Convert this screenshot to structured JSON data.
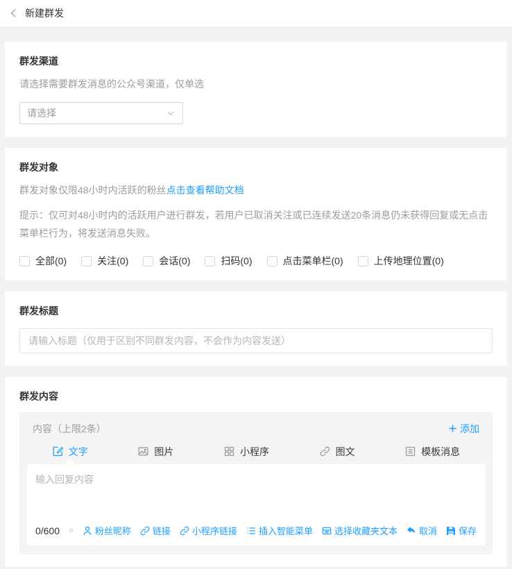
{
  "colors": {
    "accent": "#1e9fff",
    "page_bg": "#f2f2f3",
    "panel_bg": "#f4f4f5"
  },
  "header": {
    "title": "新建群发",
    "back_icon": "chevron-left"
  },
  "channel_section": {
    "title": "群发渠道",
    "description": "请选择需要群发消息的公众号渠道，仅单选",
    "select_value": "请选择",
    "select_caret_icon": "chevron-down"
  },
  "audience_section": {
    "title": "群发对象",
    "description": "群发对象仅限48小时内活跃的粉丝",
    "help_link": "点击查看帮助文档",
    "tip": "提示：仅可对48小时内的活跃用户进行群发，若用户已取消关注或已连续发送20条消息仍未获得回复或无点击菜单栏行为，将发送消息失败。",
    "checkboxes": [
      {
        "name": "all",
        "label": "全部(0)",
        "checked": false
      },
      {
        "name": "follow",
        "label": "关注(0)",
        "checked": false
      },
      {
        "name": "session",
        "label": "会话(0)",
        "checked": false
      },
      {
        "name": "scan",
        "label": "扫码(0)",
        "checked": false
      },
      {
        "name": "menu-click",
        "label": "点击菜单栏(0)",
        "checked": false
      },
      {
        "name": "location",
        "label": "上传地理位置(0)",
        "checked": false
      }
    ]
  },
  "title_section": {
    "title": "群发标题",
    "input_value": "",
    "input_placeholder": "请输入标题（仅用于区别不同群发内容，不会作为内容发送）"
  },
  "content_section": {
    "title": "群发内容",
    "panel_header": "内容（上限2条）",
    "add_label": "添加",
    "add_icon": "plus",
    "tabs": [
      {
        "name": "text",
        "label": "文字",
        "icon": "edit-square",
        "active": true
      },
      {
        "name": "image",
        "label": "图片",
        "icon": "image",
        "active": false
      },
      {
        "name": "miniprogram",
        "label": "小程序",
        "icon": "miniprogram",
        "active": false
      },
      {
        "name": "richtext",
        "label": "图文",
        "icon": "link",
        "active": false
      },
      {
        "name": "template-message",
        "label": "模板消息",
        "icon": "template",
        "active": false
      }
    ],
    "textarea_value": "",
    "textarea_placeholder": "输入回复内容",
    "char_count": "0/600",
    "emoji_icon": "smiley",
    "toolbar": [
      {
        "name": "fan-nickname",
        "label": "粉丝昵称",
        "icon": "user"
      },
      {
        "name": "link",
        "label": "链接",
        "icon": "link"
      },
      {
        "name": "miniprogram-link",
        "label": "小程序链接",
        "icon": "link"
      },
      {
        "name": "insert-smart-menu",
        "label": "插入智能菜单",
        "icon": "menu-list"
      },
      {
        "name": "favorites-text",
        "label": "选择收藏夹文本",
        "icon": "archive"
      },
      {
        "name": "cancel",
        "label": "取消",
        "icon": "undo"
      },
      {
        "name": "save",
        "label": "保存",
        "icon": "save"
      }
    ]
  }
}
